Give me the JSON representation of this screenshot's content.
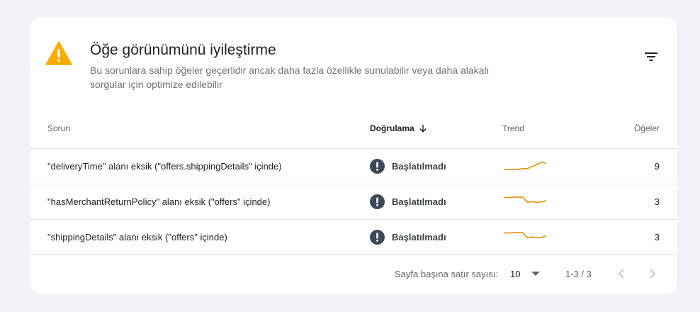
{
  "header": {
    "title": "Öğe görünümünü iyileştirme",
    "subtitle": "Bu sorunlara sahip öğeler geçerlidir ancak daha fazla özellikle sunulabilir veya daha alakalı sorgular için optimize edilebilir",
    "warning_icon": "warning-triangle-icon",
    "filter_icon": "filter-list-icon"
  },
  "table": {
    "columns": {
      "issue": "Sorun",
      "validation": "Doğrulama",
      "trend": "Trend",
      "items": "Öğeler"
    },
    "sort_icon": "arrow-down-icon",
    "rows": [
      {
        "issue": "\"deliveryTime\" alanı eksik (\"offers.shippingDetails\" içinde)",
        "status": "Başlatılmadı",
        "count": "9",
        "trend": [
          1,
          1,
          1,
          1,
          1.2,
          1.2,
          1.8,
          2.3,
          3,
          2.6
        ]
      },
      {
        "issue": "\"hasMerchantReturnPolicy\" alanı eksik (\"offers\" içinde)",
        "status": "Başlatılmadı",
        "count": "3",
        "trend": [
          3,
          3,
          3.1,
          3.1,
          3.1,
          1.7,
          1.9,
          1.7,
          1.8,
          2.2
        ]
      },
      {
        "issue": "\"shippingDetails\" alanı eksik (\"offers\" içinde)",
        "status": "Başlatılmadı",
        "count": "3",
        "trend": [
          3,
          3,
          3.1,
          3.1,
          3.1,
          1.7,
          1.9,
          1.7,
          1.8,
          2.2
        ]
      }
    ],
    "status_icon": "exclamation-circle-icon"
  },
  "pagination": {
    "rows_per_page_label": "Sayfa başına satır sayısı:",
    "rows_per_page_value": "10",
    "range": "1-3 / 3"
  },
  "colors": {
    "accent_warning": "#f9ab00",
    "trend_line": "#e8910c",
    "status_icon": "#3c4a57"
  }
}
